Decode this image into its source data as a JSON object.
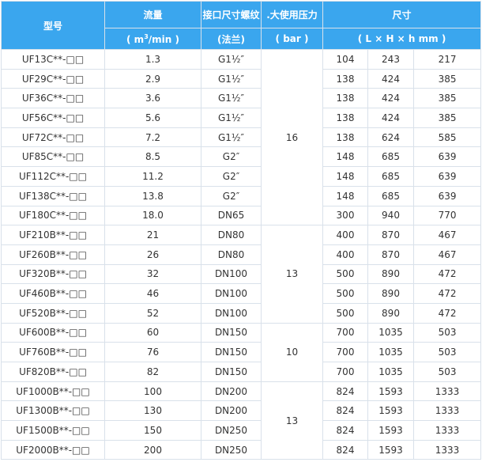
{
  "header": {
    "model": "型号",
    "flow": "流量",
    "flow_unit_pre": "( m",
    "flow_unit_sup": "3",
    "flow_unit_post": "/min )",
    "port": "接口尺寸螺纹",
    "port_unit": "(法兰)",
    "pressure": ".大使用压力",
    "pressure_unit": "( bar )",
    "size": "尺寸",
    "size_unit": "( L  ×  H  ×  h  mm )"
  },
  "rows": [
    {
      "model": "UF13C**-□□",
      "flow": "1.3",
      "port": "G1½″",
      "L": "104",
      "H": "243",
      "h": "217"
    },
    {
      "model": "UF29C**-□□",
      "flow": "2.9",
      "port": "G1½″",
      "L": "138",
      "H": "424",
      "h": "385"
    },
    {
      "model": "UF36C**-□□",
      "flow": "3.6",
      "port": "G1½″",
      "L": "138",
      "H": "424",
      "h": "385"
    },
    {
      "model": "UF56C**-□□",
      "flow": "5.6",
      "port": "G1½″",
      "L": "138",
      "H": "424",
      "h": "385"
    },
    {
      "model": "UF72C**-□□",
      "flow": "7.2",
      "port": "G1½″",
      "L": "138",
      "H": "624",
      "h": "585"
    },
    {
      "model": "UF85C**-□□",
      "flow": "8.5",
      "port": "G2″",
      "L": "148",
      "H": "685",
      "h": "639"
    },
    {
      "model": "UF112C**-□□",
      "flow": "11.2",
      "port": "G2″",
      "L": "148",
      "H": "685",
      "h": "639"
    },
    {
      "model": "UF138C**-□□",
      "flow": "13.8",
      "port": "G2″",
      "L": "148",
      "H": "685",
      "h": "639"
    },
    {
      "model": "UF180C**-□□",
      "flow": "18.0",
      "port": "DN65",
      "L": "300",
      "H": "940",
      "h": "770"
    },
    {
      "model": "UF210B**-□□",
      "flow": "21",
      "port": "DN80",
      "L": "400",
      "H": "870",
      "h": "467"
    },
    {
      "model": "UF260B**-□□",
      "flow": "26",
      "port": "DN80",
      "L": "400",
      "H": "870",
      "h": "467"
    },
    {
      "model": "UF320B**-□□",
      "flow": "32",
      "port": "DN100",
      "L": "500",
      "H": "890",
      "h": "472"
    },
    {
      "model": "UF460B**-□□",
      "flow": "46",
      "port": "DN100",
      "L": "500",
      "H": "890",
      "h": "472"
    },
    {
      "model": "UF520B**-□□",
      "flow": "52",
      "port": "DN100",
      "L": "500",
      "H": "890",
      "h": "472"
    },
    {
      "model": "UF600B**-□□",
      "flow": "60",
      "port": "DN150",
      "L": "700",
      "H": "1035",
      "h": "503"
    },
    {
      "model": "UF760B**-□□",
      "flow": "76",
      "port": "DN150",
      "L": "700",
      "H": "1035",
      "h": "503"
    },
    {
      "model": "UF820B**-□□",
      "flow": "82",
      "port": "DN150",
      "L": "700",
      "H": "1035",
      "h": "503"
    },
    {
      "model": "UF1000B**-□□",
      "flow": "100",
      "port": "DN200",
      "L": "824",
      "H": "1593",
      "h": "1333"
    },
    {
      "model": "UF1300B**-□□",
      "flow": "130",
      "port": "DN200",
      "L": "824",
      "H": "1593",
      "h": "1333"
    },
    {
      "model": "UF1500B**-□□",
      "flow": "150",
      "port": "DN250",
      "L": "824",
      "H": "1593",
      "h": "1333"
    },
    {
      "model": "UF2000B**-□□",
      "flow": "200",
      "port": "DN250",
      "L": "824",
      "H": "1593",
      "h": "1333"
    }
  ],
  "pressure_groups": [
    {
      "value": "16",
      "start": 0,
      "span": 9
    },
    {
      "value": "13",
      "start": 9,
      "span": 5
    },
    {
      "value": "10",
      "start": 14,
      "span": 3
    },
    {
      "value": "13",
      "start": 17,
      "span": 4
    }
  ]
}
